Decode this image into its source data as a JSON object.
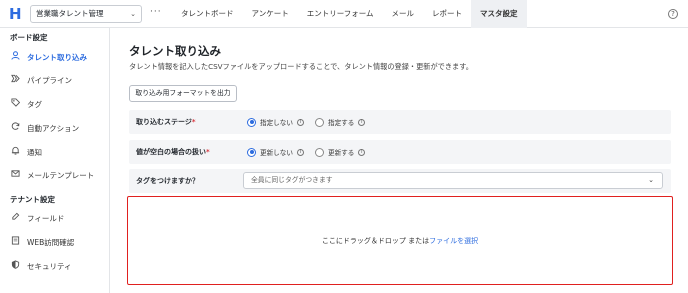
{
  "header": {
    "logo": "H",
    "workspace": "営業職タレント管理",
    "more": "···",
    "nav": [
      "タレントボード",
      "アンケート",
      "エントリーフォーム",
      "メール",
      "レポート",
      "マスタ設定"
    ],
    "active_nav": "マスタ設定",
    "help": "?"
  },
  "sidebar": {
    "section1": "ボード設定",
    "items1": [
      {
        "label": "タレント取り込み",
        "icon": "person-icon",
        "active": true
      },
      {
        "label": "パイプライン",
        "icon": "pipeline-icon"
      },
      {
        "label": "タグ",
        "icon": "tag-icon"
      },
      {
        "label": "自動アクション",
        "icon": "refresh-icon"
      },
      {
        "label": "通知",
        "icon": "bell-icon"
      },
      {
        "label": "メールテンプレート",
        "icon": "mail-icon"
      }
    ],
    "section2": "テナント設定",
    "items2": [
      {
        "label": "フィールド",
        "icon": "field-icon"
      },
      {
        "label": "WEB訪問確認",
        "icon": "document-icon"
      },
      {
        "label": "セキュリティ",
        "icon": "shield-icon"
      }
    ]
  },
  "main": {
    "title": "タレント取り込み",
    "description": "タレント情報を記入したCSVファイルをアップロードすることで、タレント情報の登録・更新ができます。",
    "format_button": "取り込み用フォーマットを出力",
    "stage": {
      "label": "取り込むステージ",
      "required": "*",
      "option1": "指定しない",
      "option2": "指定する",
      "selected": "指定しない"
    },
    "empty_value": {
      "label": "値が空白の場合の扱い",
      "required": "*",
      "option1": "更新しない",
      "option2": "更新する",
      "selected": "更新しない"
    },
    "tag": {
      "label": "タグをつけますか？",
      "placeholder": "全員に同じタグがつきます"
    },
    "dropzone": {
      "text": "ここにドラッグ＆ドロップ または",
      "link": "ファイルを選択"
    }
  },
  "colors": {
    "accent": "#2d6cdf",
    "highlight_border": "#e0201f",
    "required": "#d9363e"
  }
}
